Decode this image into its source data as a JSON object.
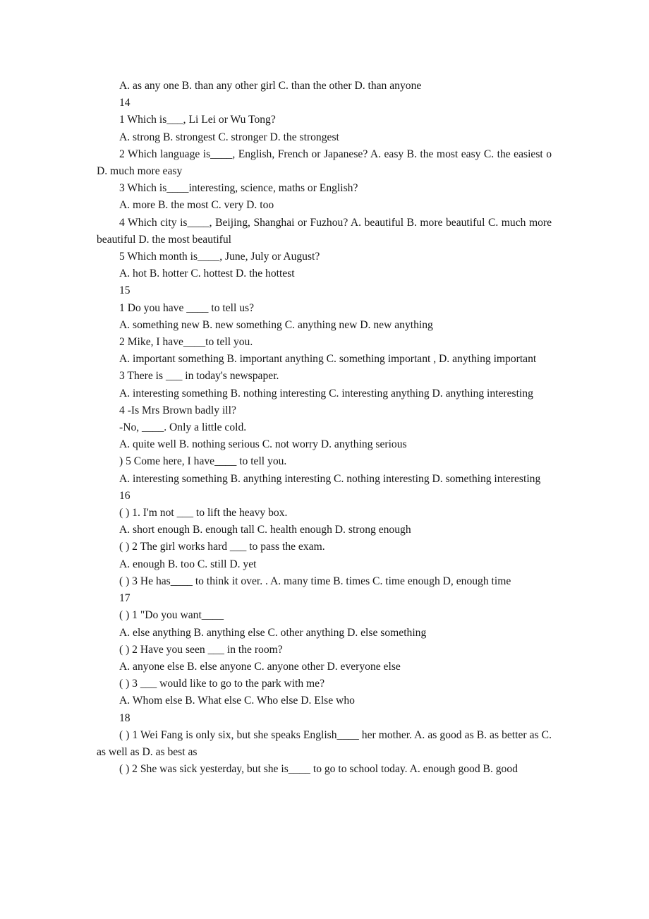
{
  "document": {
    "kind": "scanned-worksheet",
    "background_color": "#ffffff",
    "text_color": "#161616",
    "lines": [
      {
        "id": "l1",
        "text": "A. as any one B. than any other girl C. than the other D. than anyone"
      },
      {
        "id": "l2",
        "text": "14"
      },
      {
        "id": "l3",
        "text": "1 Which is___, Li Lei or Wu Tong?"
      },
      {
        "id": "l4",
        "text": "A. strong B. strongest C. stronger D. the strongest"
      },
      {
        "id": "l5",
        "text": "2 Which language is____, English, French or Japanese? A. easy B. the most easy C. the easiest o D. much more easy"
      },
      {
        "id": "l6",
        "text": "3 Which is____interesting, science, maths or English?"
      },
      {
        "id": "l7",
        "text": "A. more B. the most C. very D. too"
      },
      {
        "id": "l8",
        "text": "4 Which city is____, Beijing, Shanghai or Fuzhou? A. beautiful B. more beautiful C. much more beautiful D. the most beautiful"
      },
      {
        "id": "l9",
        "text": "5 Which month is____, June, July or August?"
      },
      {
        "id": "l10",
        "text": "A. hot B. hotter C. hottest D. the hottest"
      },
      {
        "id": "l11",
        "text": "15"
      },
      {
        "id": "l12",
        "text": "1 Do you have ____ to tell us?"
      },
      {
        "id": "l13",
        "text": "A. something new B. new something C. anything new D. new anything"
      },
      {
        "id": "l14",
        "text": "2 Mike, I have____to tell you."
      },
      {
        "id": "l15",
        "text": "A. important something B. important anything C. something important , D. anything important"
      },
      {
        "id": "l16",
        "text": "3 There is ___ in today's newspaper."
      },
      {
        "id": "l17",
        "text": "A. interesting something B. nothing interesting C. interesting anything D. anything interesting"
      },
      {
        "id": "l18",
        "text": "4 -Is Mrs Brown badly ill?"
      },
      {
        "id": "l19",
        "text": "-No, ____. Only a little cold."
      },
      {
        "id": "l20",
        "text": "A. quite well B. nothing serious C. not worry D. anything serious"
      },
      {
        "id": "l21",
        "text": ") 5 Come here, I have____ to tell you."
      },
      {
        "id": "l22",
        "text": "A. interesting something B. anything interesting C. nothing interesting D. something interesting"
      },
      {
        "id": "l23",
        "text": "16"
      },
      {
        "id": "l24",
        "text": "( ) 1. I'm not ___ to lift the heavy box."
      },
      {
        "id": "l25",
        "text": "A. short enough B. enough tall C. health enough D. strong enough"
      },
      {
        "id": "l26",
        "text": "( ) 2 The girl works hard ___ to pass the exam."
      },
      {
        "id": "l27",
        "text": "A. enough B. too C. still D. yet"
      },
      {
        "id": "l28",
        "text": "( ) 3 He has____ to think it over. . A. many time B. times C. time enough D, enough time"
      },
      {
        "id": "l29",
        "text": "17"
      },
      {
        "id": "l30",
        "text": "( ) 1 \"Do you want____"
      },
      {
        "id": "l31",
        "text": "A. else anything B. anything else C. other anything D. else something"
      },
      {
        "id": "l32",
        "text": "( ) 2 Have you seen ___ in the room?"
      },
      {
        "id": "l33",
        "text": "A. anyone else B. else anyone C. anyone other D. everyone else"
      },
      {
        "id": "l34",
        "text": "( ) 3 ___ would like to go to the park with me?"
      },
      {
        "id": "l35",
        "text": "A. Whom else B. What else C. Who else D. Else who"
      },
      {
        "id": "l36",
        "text": "18"
      },
      {
        "id": "l37",
        "text": "( ) 1 Wei Fang is only six, but she speaks English____ her mother. A. as good as B. as better as C. as well as D. as best as"
      },
      {
        "id": "l38",
        "text": "( ) 2 She was sick yesterday, but she is____ to go to school today. A. enough good B. good"
      }
    ]
  }
}
